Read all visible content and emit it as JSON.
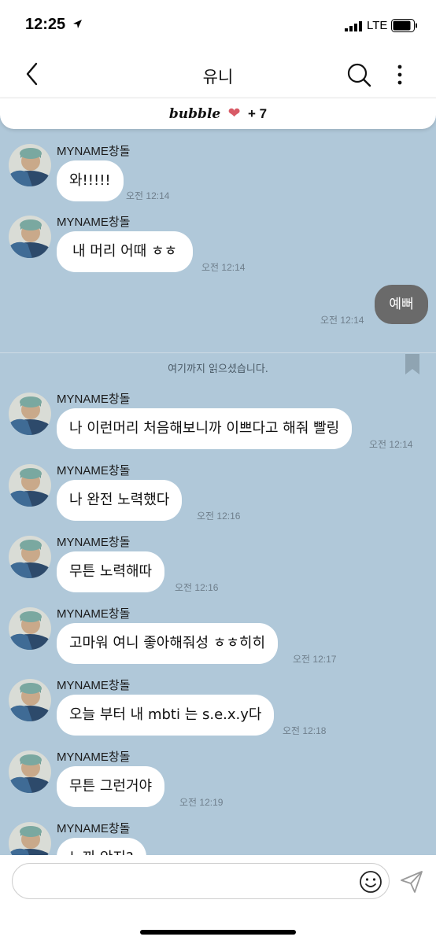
{
  "status": {
    "time": "12:25",
    "network": "LTE"
  },
  "header": {
    "title": "유니",
    "icons": [
      "back-icon",
      "search-icon",
      "more-icon"
    ]
  },
  "banner": {
    "brand": "bubble",
    "count": "+ 7"
  },
  "read_marker": "여기까지 읽으셨습니다.",
  "my_message": {
    "text": "예뻐",
    "time": "오전 12:14"
  },
  "messages": [
    {
      "sender": "MYNAME창돌",
      "text": "와!!!!!",
      "time": "오전 12:14"
    },
    {
      "sender": "MYNAME창돌",
      "text": "내 머리 어때 ㅎㅎ",
      "time": "오전 12:14"
    },
    {
      "sender": "MYNAME창돌",
      "text": "나 이런머리 처음해보니까 이쁘다고 해줘 빨링",
      "time": "오전 12:14"
    },
    {
      "sender": "MYNAME창돌",
      "text": "나 완전 노력했다",
      "time": "오전 12:16"
    },
    {
      "sender": "MYNAME창돌",
      "text": "무튼 노력해따",
      "time": "오전 12:16"
    },
    {
      "sender": "MYNAME창돌",
      "text": "고마워 여니 좋아해줘성 ㅎㅎ히히",
      "time": "오전 12:17"
    },
    {
      "sender": "MYNAME창돌",
      "text": "오늘 부터 내 mbti 는 s.e.x.y다",
      "time": "오전 12:18"
    },
    {
      "sender": "MYNAME창돌",
      "text": "무튼 그런거야",
      "time": "오전 12:19"
    },
    {
      "sender": "MYNAME창돌",
      "text": "느끼 안지?",
      "time": ""
    }
  ],
  "input": {
    "placeholder": ""
  },
  "colors": {
    "chat_bg": "#b0c8d9",
    "heart": "#d85a66",
    "my_bubble": "#6a6a6a"
  }
}
